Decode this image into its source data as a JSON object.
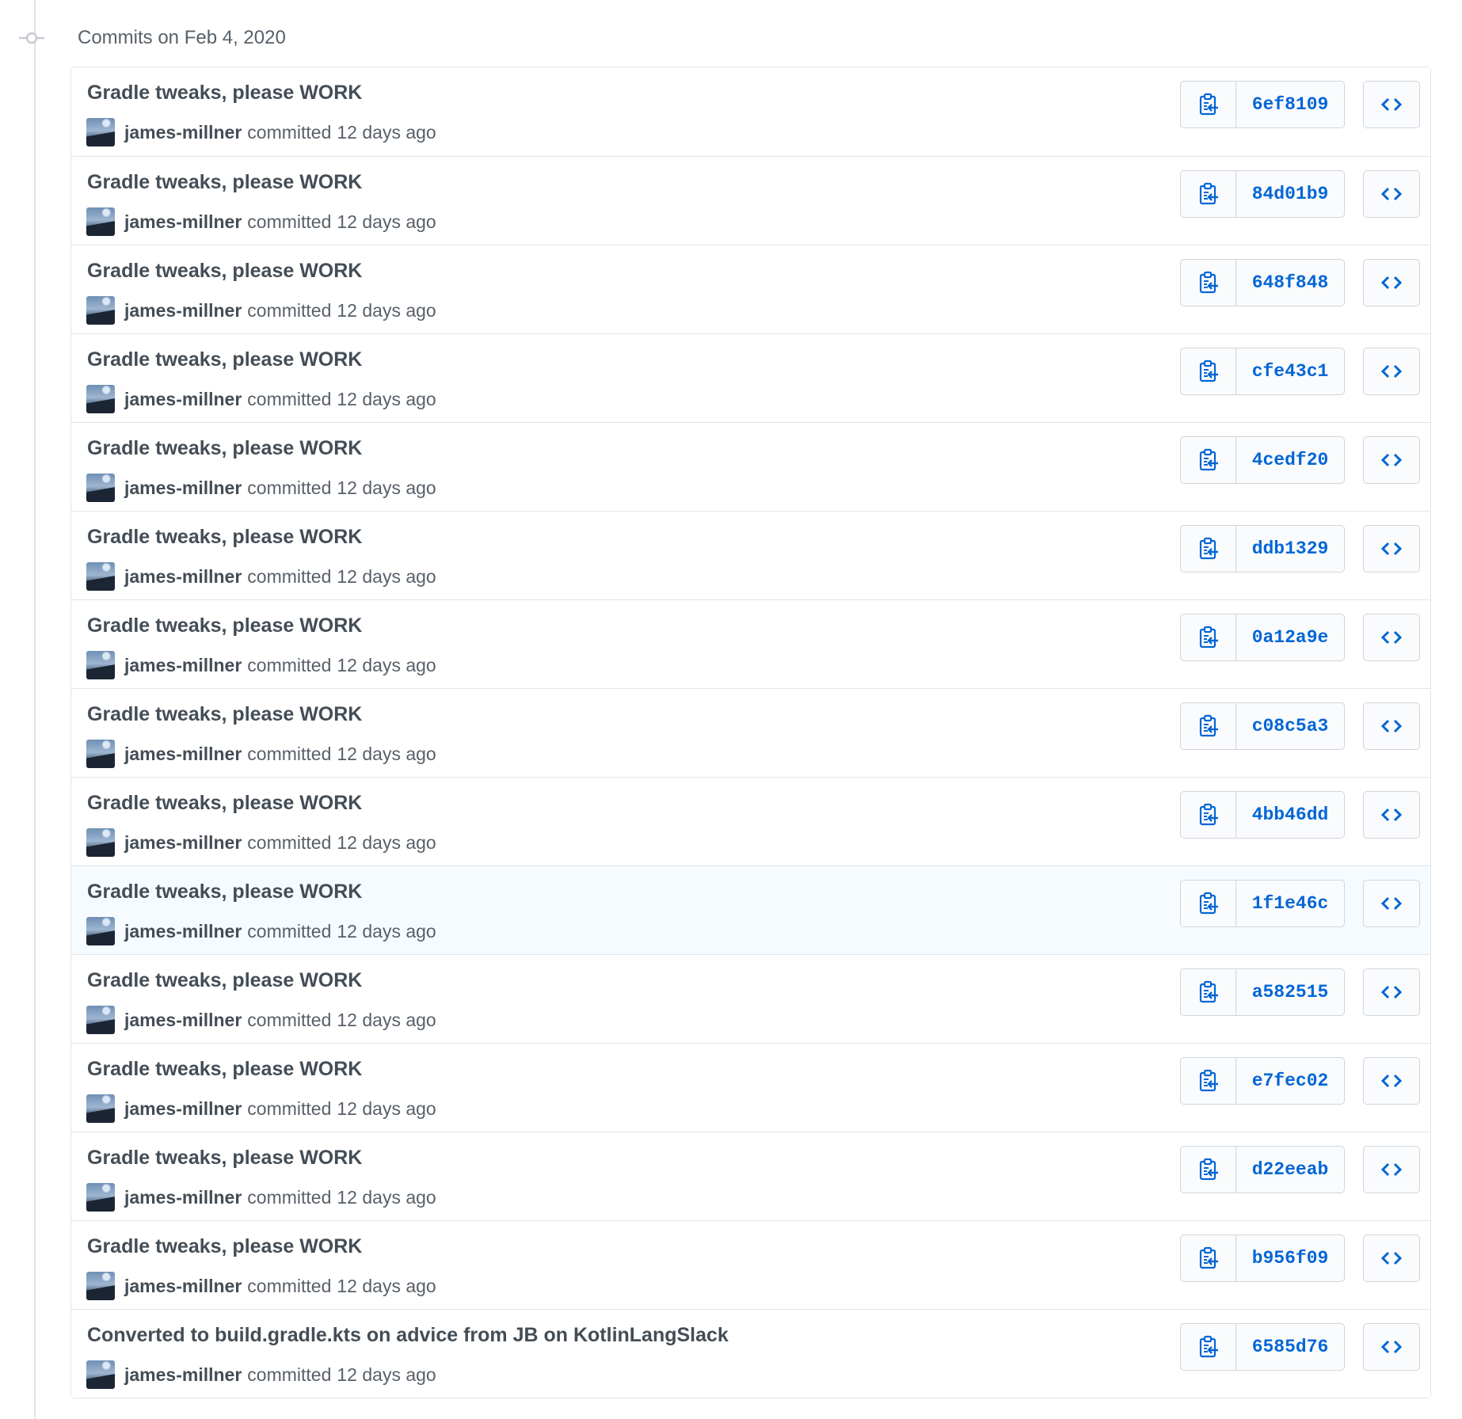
{
  "group": {
    "title": "Commits on Feb 4, 2020"
  },
  "colors": {
    "link": "#0366d6",
    "text": "#444d56",
    "muted": "#586069",
    "border": "#e1e4e8",
    "highlight": "#f6fbff"
  },
  "icons": {
    "timeline": "git-commit-icon",
    "copy": "clippy-icon",
    "browse": "code-icon",
    "avatar": "user-avatar"
  },
  "commits": [
    {
      "title": "Gradle tweaks, please WORK",
      "author": "james-millner",
      "verb": "committed",
      "time": "12 days ago",
      "sha": "6ef8109"
    },
    {
      "title": "Gradle tweaks, please WORK",
      "author": "james-millner",
      "verb": "committed",
      "time": "12 days ago",
      "sha": "84d01b9"
    },
    {
      "title": "Gradle tweaks, please WORK",
      "author": "james-millner",
      "verb": "committed",
      "time": "12 days ago",
      "sha": "648f848"
    },
    {
      "title": "Gradle tweaks, please WORK",
      "author": "james-millner",
      "verb": "committed",
      "time": "12 days ago",
      "sha": "cfe43c1"
    },
    {
      "title": "Gradle tweaks, please WORK",
      "author": "james-millner",
      "verb": "committed",
      "time": "12 days ago",
      "sha": "4cedf20"
    },
    {
      "title": "Gradle tweaks, please WORK",
      "author": "james-millner",
      "verb": "committed",
      "time": "12 days ago",
      "sha": "ddb1329"
    },
    {
      "title": "Gradle tweaks, please WORK",
      "author": "james-millner",
      "verb": "committed",
      "time": "12 days ago",
      "sha": "0a12a9e"
    },
    {
      "title": "Gradle tweaks, please WORK",
      "author": "james-millner",
      "verb": "committed",
      "time": "12 days ago",
      "sha": "c08c5a3"
    },
    {
      "title": "Gradle tweaks, please WORK",
      "author": "james-millner",
      "verb": "committed",
      "time": "12 days ago",
      "sha": "4bb46dd"
    },
    {
      "title": "Gradle tweaks, please WORK",
      "author": "james-millner",
      "verb": "committed",
      "time": "12 days ago",
      "sha": "1f1e46c",
      "highlighted": true
    },
    {
      "title": "Gradle tweaks, please WORK",
      "author": "james-millner",
      "verb": "committed",
      "time": "12 days ago",
      "sha": "a582515"
    },
    {
      "title": "Gradle tweaks, please WORK",
      "author": "james-millner",
      "verb": "committed",
      "time": "12 days ago",
      "sha": "e7fec02"
    },
    {
      "title": "Gradle tweaks, please WORK",
      "author": "james-millner",
      "verb": "committed",
      "time": "12 days ago",
      "sha": "d22eeab"
    },
    {
      "title": "Gradle tweaks, please WORK",
      "author": "james-millner",
      "verb": "committed",
      "time": "12 days ago",
      "sha": "b956f09"
    },
    {
      "title": "Converted to build.gradle.kts on advice from JB on KotlinLangSlack",
      "author": "james-millner",
      "verb": "committed",
      "time": "12 days ago",
      "sha": "6585d76"
    }
  ]
}
